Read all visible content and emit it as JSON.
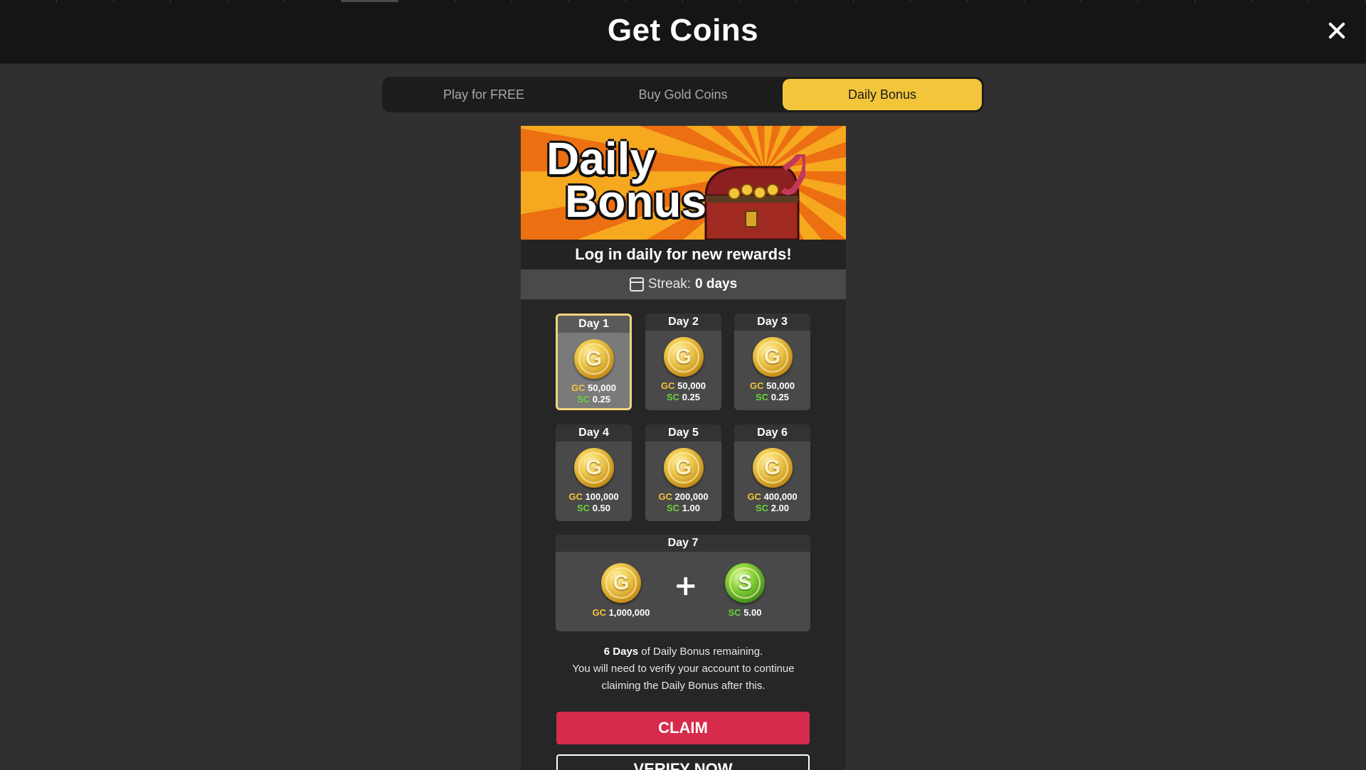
{
  "header": {
    "title": "Get Coins",
    "close_icon": "close-icon"
  },
  "tabs": [
    {
      "label": "Play for FREE",
      "active": false
    },
    {
      "label": "Buy Gold Coins",
      "active": false
    },
    {
      "label": "Daily Bonus",
      "active": true
    }
  ],
  "banner": {
    "line1": "Daily",
    "line2": "Bonus"
  },
  "tagline": "Log in daily for new rewards!",
  "streak": {
    "label": "Streak:",
    "value": "0 days",
    "icon": "calendar-icon"
  },
  "days": [
    {
      "label": "Day 1",
      "gc": "50,000",
      "sc": "0.25",
      "selected": true
    },
    {
      "label": "Day 2",
      "gc": "50,000",
      "sc": "0.25",
      "selected": false
    },
    {
      "label": "Day 3",
      "gc": "50,000",
      "sc": "0.25",
      "selected": false
    },
    {
      "label": "Day 4",
      "gc": "100,000",
      "sc": "0.50",
      "selected": false
    },
    {
      "label": "Day 5",
      "gc": "200,000",
      "sc": "1.00",
      "selected": false
    },
    {
      "label": "Day 6",
      "gc": "400,000",
      "sc": "2.00",
      "selected": false
    }
  ],
  "day7": {
    "label": "Day 7",
    "gc": "1,000,000",
    "sc": "5.00",
    "plus": "+"
  },
  "currency": {
    "gc_prefix": "GC",
    "sc_prefix": "SC",
    "gc_coin_letter": "G",
    "sc_coin_letter": "S"
  },
  "info": {
    "days_bold": "6 Days",
    "days_rest": " of Daily Bonus remaining.",
    "line2": "You will need to verify your account to continue",
    "line3": "claiming the Daily Bonus after this."
  },
  "buttons": {
    "claim": "CLAIM",
    "verify": "VERIFY NOW"
  },
  "colors": {
    "accent_yellow": "#f3c53b",
    "claim_red": "#d62b4b",
    "sc_green": "#6bd13a"
  }
}
